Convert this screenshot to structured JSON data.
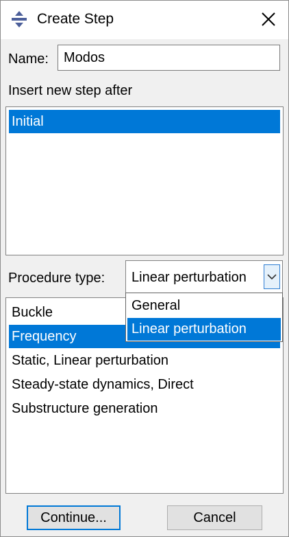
{
  "window": {
    "title": "Create Step"
  },
  "name_field": {
    "label": "Name:",
    "value": "Modos"
  },
  "insert_after": {
    "label": "Insert new step after",
    "items": [
      "Initial"
    ],
    "selected": "Initial"
  },
  "procedure": {
    "label": "Procedure type:",
    "value": "Linear perturbation",
    "options": [
      "General",
      "Linear perturbation"
    ]
  },
  "procedures_list": {
    "items": [
      "Buckle",
      "Frequency",
      "Static, Linear perturbation",
      "Steady-state dynamics, Direct",
      "Substructure generation"
    ],
    "selected": "Frequency"
  },
  "buttons": {
    "continue": "Continue...",
    "cancel": "Cancel"
  },
  "colors": {
    "selection": "#0078d7",
    "dialog_bg": "#f0f0f0"
  },
  "icons": {
    "app": "abaqus-logo-icon",
    "close": "close-icon",
    "dropdown": "chevron-down-icon"
  }
}
